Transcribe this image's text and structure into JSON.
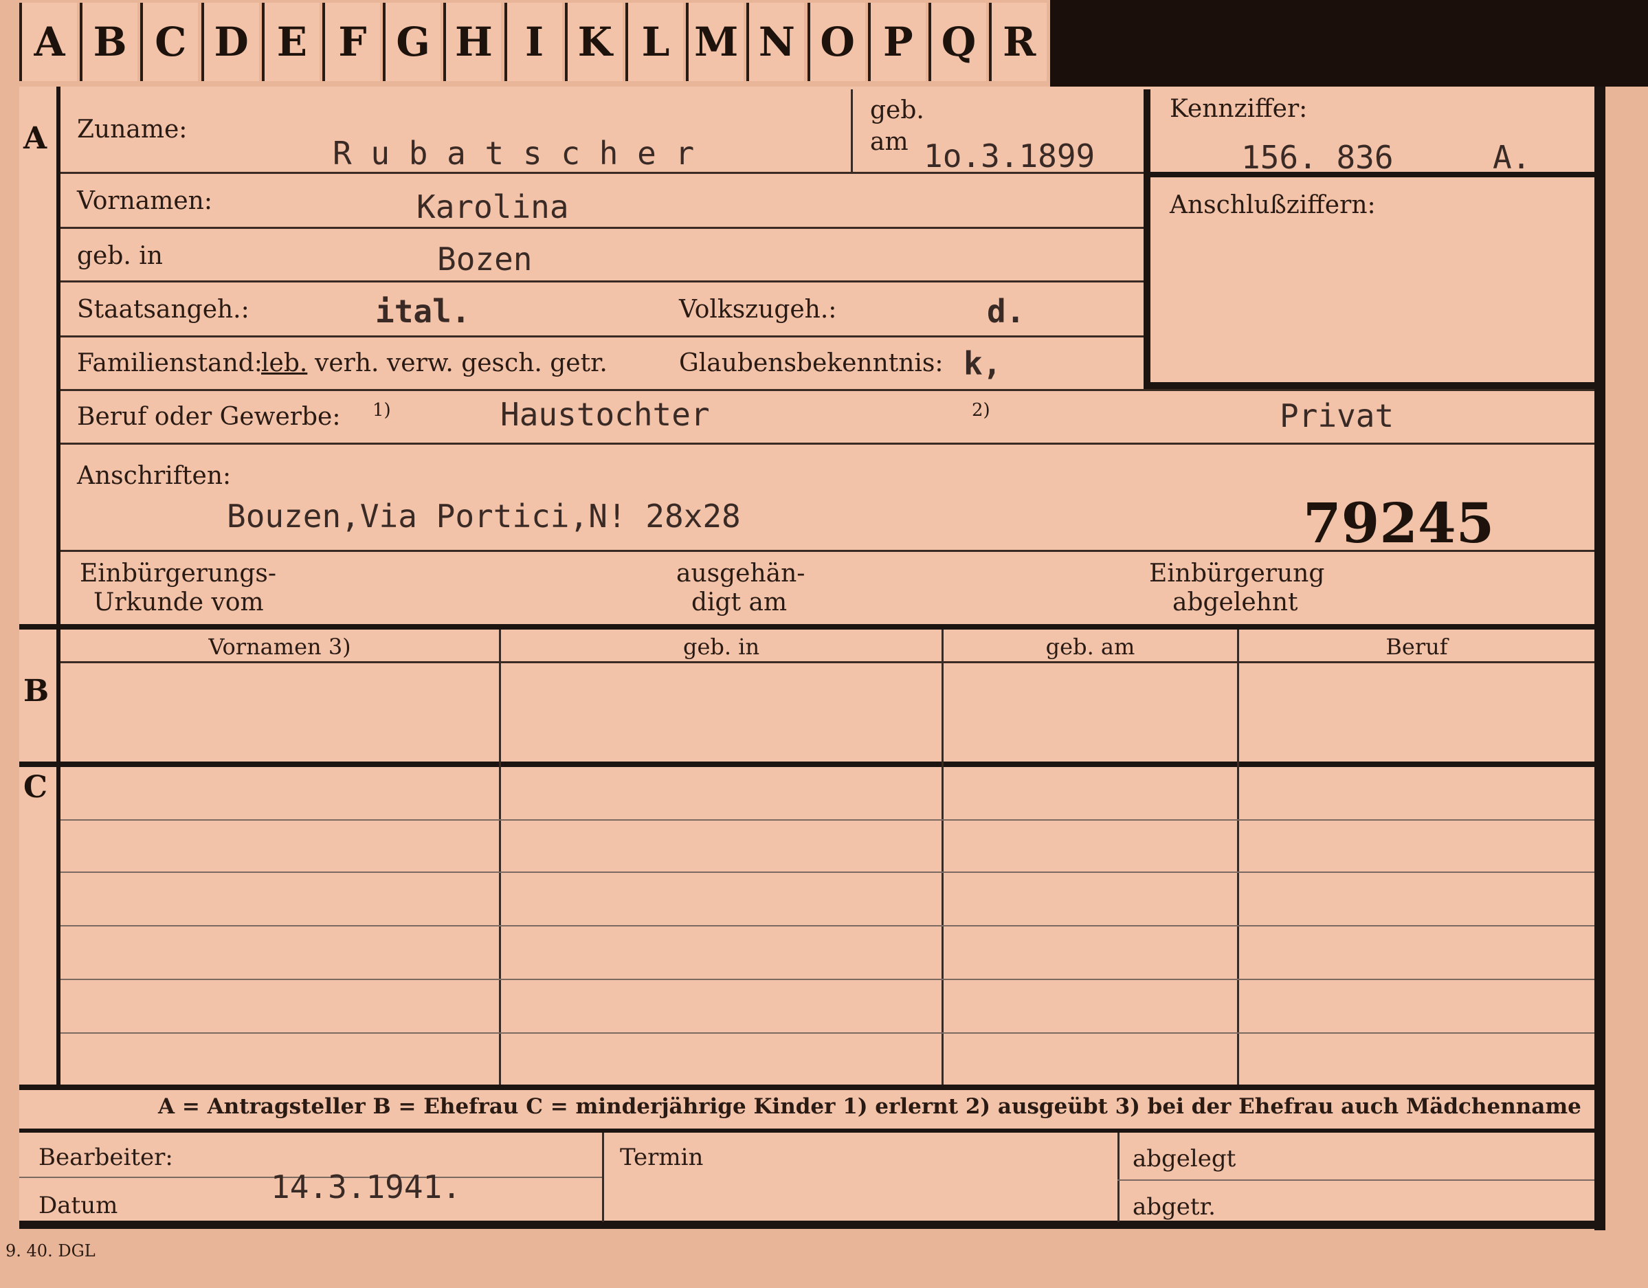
{
  "tabs": [
    "A",
    "B",
    "C",
    "D",
    "E",
    "F",
    "G",
    "H",
    "I",
    "K",
    "L",
    "M",
    "N",
    "O",
    "P",
    "Q",
    "R"
  ],
  "section_marks": {
    "a": "A",
    "b": "B",
    "c": "C"
  },
  "labels": {
    "zuname": "Zuname:",
    "geb": "geb.",
    "am": "am",
    "kennziffer": "Kennziffer:",
    "vornamen": "Vornamen:",
    "anschlussziffern": "Anschlußziffern:",
    "geb_in": "geb. in",
    "staatsangeh": "Staatsangeh.:",
    "volkszugeh": "Volkszugeh.:",
    "familienstand": "Familienstand:",
    "fam_options_leb": "leb.",
    "fam_options_rest": "verh. verw. gesch. getr.",
    "glaubensbekenntnis": "Glaubensbekenntnis:",
    "beruf": "Beruf oder Gewerbe:",
    "fn1": "1)",
    "fn2": "2)",
    "anschriften": "Anschriften:",
    "einb_urkunde_1": "Einbürgerungs-",
    "einb_urkunde_2": "Urkunde vom",
    "ausgehaen_1": "ausgehän-",
    "ausgehaen_2": "digt am",
    "einb_abgelehnt_1": "Einbürgerung",
    "einb_abgelehnt_2": "abgelehnt",
    "col_vornamen": "Vornamen 3)",
    "col_geb_in": "geb. in",
    "col_geb_am": "geb. am",
    "col_beruf": "Beruf",
    "legend": "A = Antragsteller    B = Ehefrau    C = minderjährige Kinder    1) erlernt    2) ausgeübt    3) bei der Ehefrau auch Mädchenname",
    "bearbeiter": "Bearbeiter:",
    "datum": "Datum",
    "termin": "Termin",
    "abgelegt": "abgelegt",
    "abgetr": "abgetr.",
    "printer": "9. 40. DGL"
  },
  "values": {
    "zuname": "R u b a t s c h e r",
    "geb_am": "1o.3.1899",
    "kennziffer": "156. 836",
    "kennziffer_suffix": "A.",
    "vornamen": "Karolina",
    "geb_in": "Bozen",
    "staatsangeh": "ital.",
    "volkszugeh": "d.",
    "glaubensbekenntnis": "k,",
    "beruf_erlernt": "Haustochter",
    "beruf_ausgeuebt": "Privat",
    "anschrift": "Bouzen,Via Portici,N! 28x28",
    "stamp_number": "79245",
    "datum": "14.3.1941."
  }
}
